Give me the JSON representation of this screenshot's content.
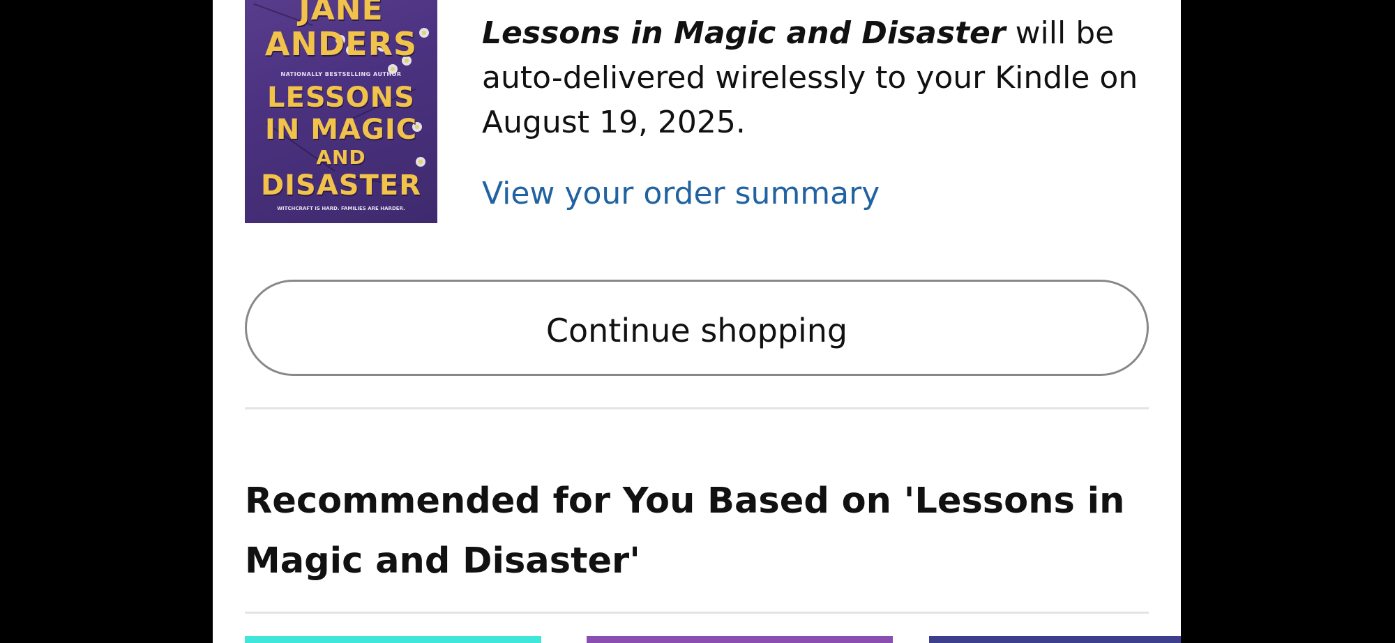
{
  "product": {
    "cover": {
      "author_line1": "JANE",
      "author_line2": "ANDERS",
      "tagline": "NATIONALLY BESTSELLING AUTHOR",
      "title_line1": "LESSONS",
      "title_line2": "IN MAGIC",
      "title_line3": "AND",
      "title_line4": "DISASTER",
      "subtitle": "WITCHCRAFT IS HARD. FAMILIES ARE HARDER.",
      "bg_color": "#4b3280",
      "text_color": "#f2c34a"
    },
    "title": "Lessons in Magic and Disaster",
    "delivery_text": " will be auto-delivered wirelessly to your Kindle on August 19, 2025.",
    "order_link_label": "View your order summary",
    "link_color": "#2162a1"
  },
  "actions": {
    "continue_label": "Continue shopping"
  },
  "recommendations": {
    "heading_line1": "Recommended for You Based on 'Lessons in",
    "heading_line2": "Magic and Disaster'",
    "thumb_colors": [
      "#3fe6da",
      "#8a4db0",
      "#3d3f8d"
    ]
  }
}
